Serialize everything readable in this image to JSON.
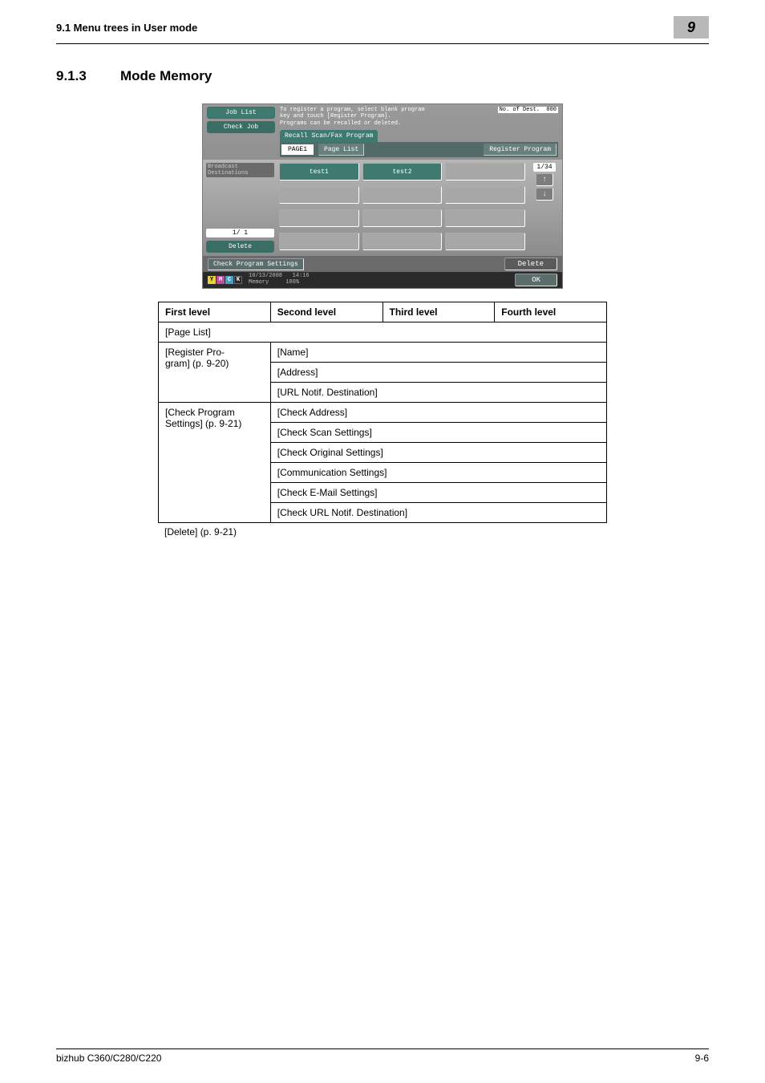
{
  "header": {
    "left": "9.1      Menu trees in User mode",
    "badge": "9"
  },
  "section": {
    "num": "9.1.3",
    "title": "Mode Memory"
  },
  "shot": {
    "jobList": "Job List",
    "checkJob": "Check Job",
    "desc1": "To register a program, select blank program",
    "desc2": "key and touch [Register Program].",
    "desc3": "Programs can be recalled or deleted.",
    "noOfLabel": "No. of Dest.",
    "noOfVal": "000",
    "tab": "Recall Scan/Fax Program",
    "page1": "PAGE1",
    "pageList": "Page List",
    "regProg": "Register Program",
    "bcast": "Broadcast Destinations",
    "test1": "test1",
    "test2": "test2",
    "pageCounter": "1/34",
    "arrowUp": "↑",
    "arrowDown": "↓",
    "leftCount": "1/   1",
    "delete": "Delete",
    "cps": "Check Program Settings",
    "delBtn": "Delete",
    "y": "Y",
    "m": "M",
    "c": "C",
    "k": "K",
    "date": "10/13/2008",
    "time": "14:16",
    "memory": "Memory",
    "mem100": "100%",
    "ok": "OK"
  },
  "table": {
    "h1": "First level",
    "h2": "Second level",
    "h3": "Third level",
    "h4": "Fourth level",
    "r1c1": "[Page List]",
    "r2c1a": "[Register Pro-",
    "r2c1b": "gram] (p. 9-20)",
    "r2c2": "[Name]",
    "r3c2": "[Address]",
    "r4c2": "[URL Notif. Destination]",
    "r5c1a": "[Check Program",
    "r5c1b": "Settings] (p. 9-21)",
    "r5c2": "[Check Address]",
    "r6c2": "[Check Scan Settings]",
    "r7c2": "[Check Original Settings]",
    "r8c2": "[Communication Settings]",
    "r9c2": "[Check E-Mail Settings]",
    "r10c2": "[Check URL Notif. Destination]"
  },
  "belowTable": "[Delete] (p. 9-21)",
  "footer": {
    "left": "bizhub C360/C280/C220",
    "right": "9-6"
  }
}
